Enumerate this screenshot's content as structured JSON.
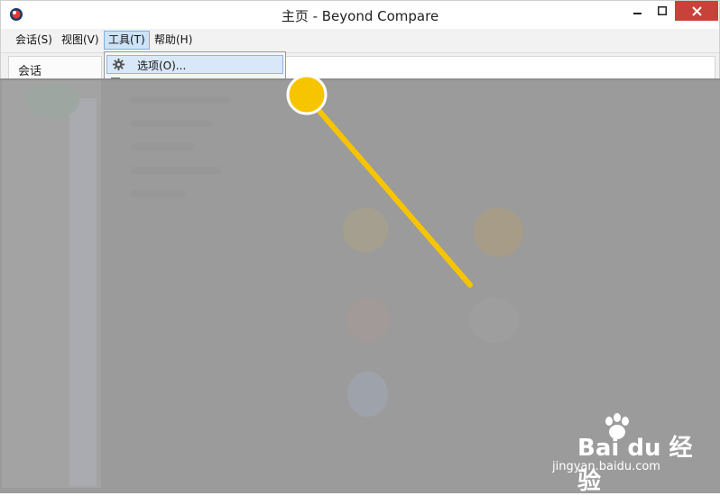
{
  "window": {
    "title": "主页 - Beyond Compare"
  },
  "menubar": {
    "items": [
      {
        "label": "会话(S)"
      },
      {
        "label": "视图(V)"
      },
      {
        "label": "工具(T)"
      },
      {
        "label": "帮助(H)"
      }
    ]
  },
  "left_pane": {
    "title": "会话"
  },
  "dropdown": {
    "items": [
      {
        "label": "选项(O)...",
        "icon": "gear-icon"
      }
    ]
  },
  "watermark": {
    "brand": "Bai du 经验",
    "url": "jingyan.baidu.com"
  },
  "colors": {
    "accent": "#f7c400",
    "close_button": "#c7433a",
    "menu_highlight": "#cde3f7"
  }
}
